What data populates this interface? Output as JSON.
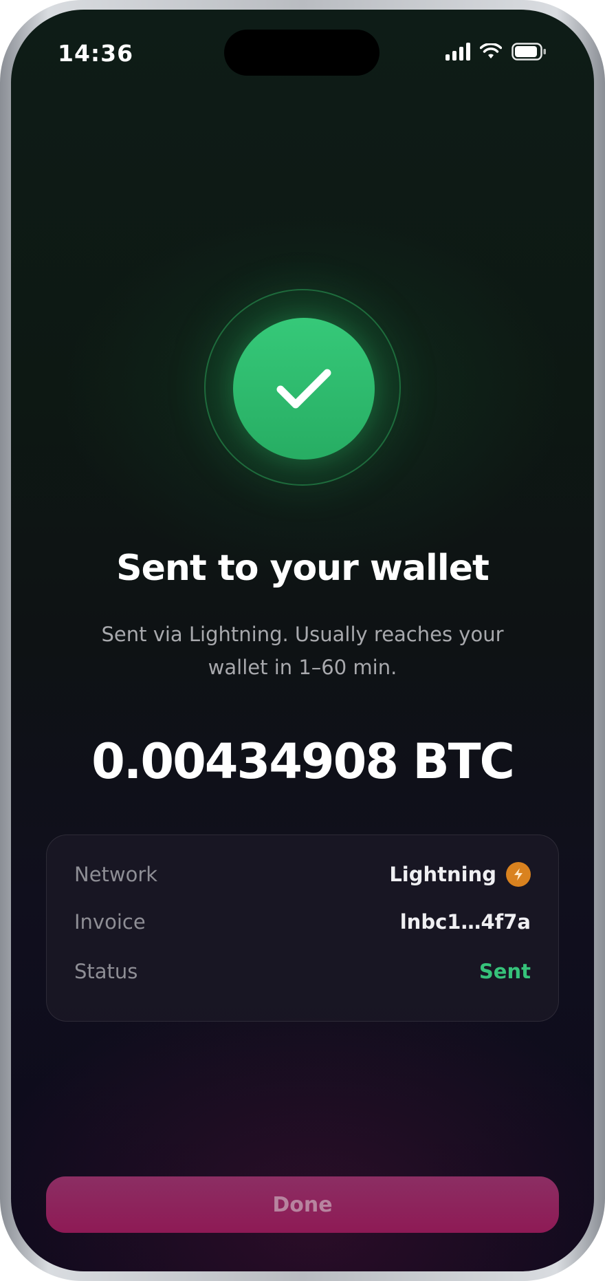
{
  "status_bar": {
    "time": "14:36",
    "icons": [
      "cellular-signal-icon",
      "wifi-icon",
      "battery-icon"
    ]
  },
  "success": {
    "icon": "checkmark-icon",
    "accent_color": "#2fbf72",
    "title": "Sent to your wallet",
    "subtitle": "Sent via Lightning. Usually reaches your wallet in 1–60 min."
  },
  "amount": "0.00434908 BTC",
  "details": {
    "rows": [
      {
        "label": "Network",
        "value": "Lightning",
        "icon": "lightning-bolt-icon"
      },
      {
        "label": "Invoice",
        "value": "lnbc1…4f7a"
      },
      {
        "label": "Status",
        "value": "Sent",
        "value_color": "#36c27a"
      }
    ]
  },
  "actions": {
    "done_label": "Done",
    "done_color": "#8e1a55"
  }
}
